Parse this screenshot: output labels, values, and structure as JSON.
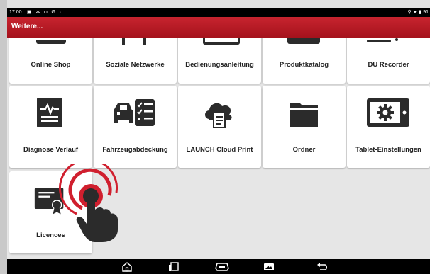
{
  "status_bar": {
    "time": "17:00",
    "left_icons": "▣ ✲ ◘ G ·",
    "right_text": "⚲ ▼ ▮ 91"
  },
  "header": {
    "title": "Weitere..."
  },
  "tiles_row1": [
    {
      "label": "Online Shop"
    },
    {
      "label": "Soziale Netzwerke"
    },
    {
      "label": "Bedienungsanleitung"
    },
    {
      "label": "Produktkatalog"
    },
    {
      "label": "DU Recorder"
    }
  ],
  "tiles_row2": [
    {
      "label": "Diagnose Verlauf",
      "icon": "diagnosis-history-icon"
    },
    {
      "label": "Fahrzeugabdeckung",
      "icon": "vehicle-coverage-icon"
    },
    {
      "label": "LAUNCH Cloud Print",
      "icon": "cloud-print-icon"
    },
    {
      "label": "Ordner",
      "icon": "folder-icon"
    },
    {
      "label": "Tablet-Einstellungen",
      "icon": "tablet-settings-icon"
    }
  ],
  "tiles_row3": [
    {
      "label": "Licences",
      "icon": "certificate-icon"
    }
  ],
  "navbar": {
    "icons": [
      "home-icon",
      "recent-apps-icon",
      "vci-icon",
      "screenshot-icon",
      "back-icon"
    ]
  },
  "colors": {
    "header_red": "#b81a24",
    "icon_dark": "#2b2b2b",
    "tap_red": "#d01f2e"
  }
}
